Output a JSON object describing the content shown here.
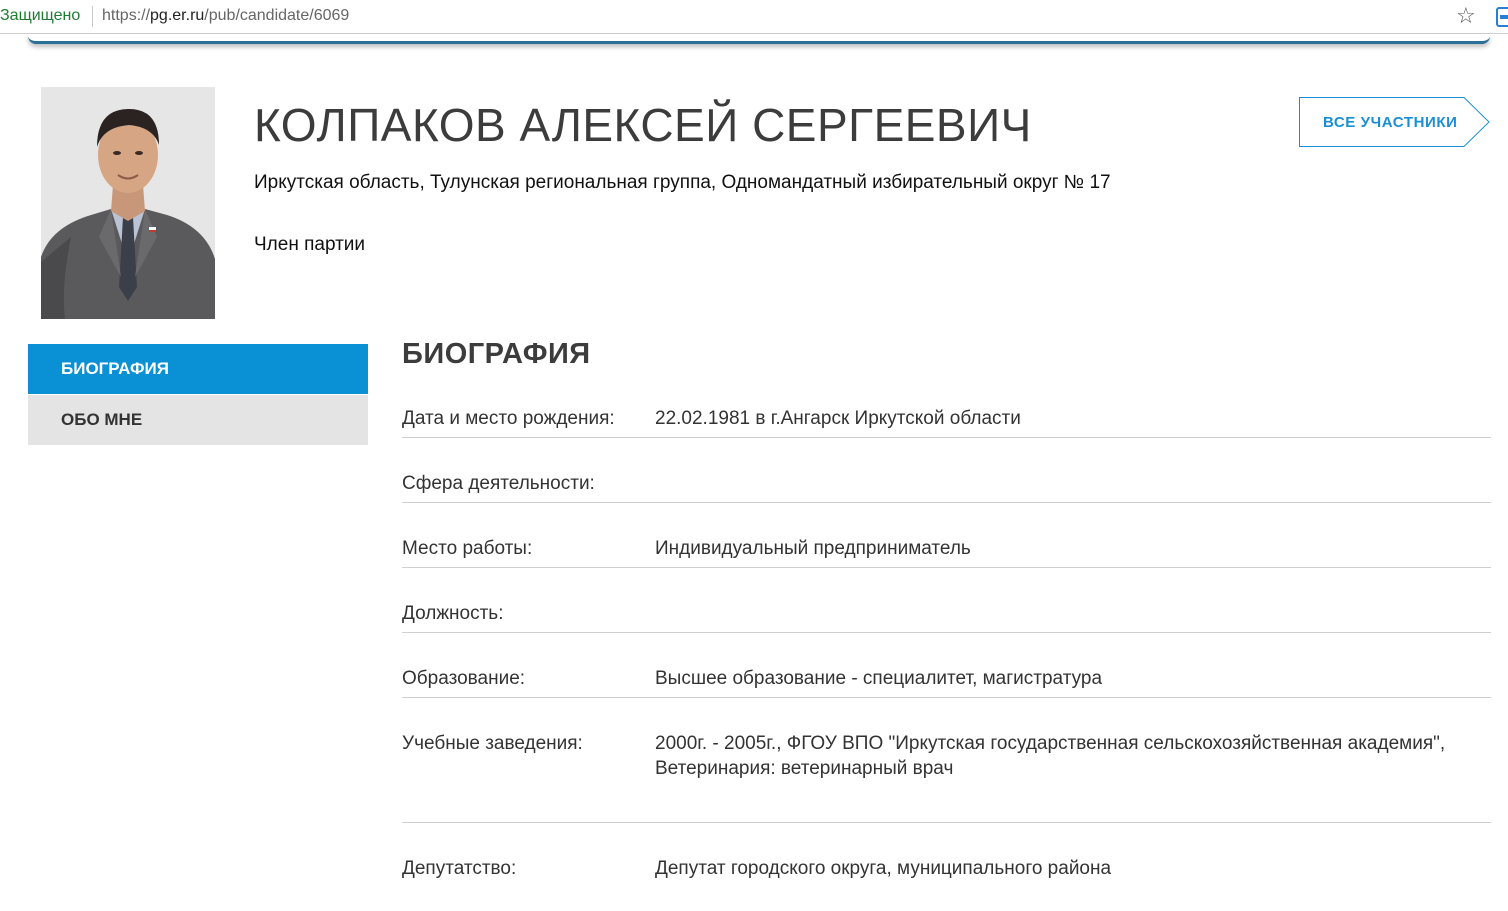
{
  "browser": {
    "secure_label": "Защищено",
    "url_prefix": "https://",
    "url_host": "pg.er.ru",
    "url_path": "/pub/candidate/6069"
  },
  "candidate": {
    "name": "КОЛПАКОВ АЛЕКСЕЙ СЕРГЕЕВИЧ",
    "region": "Иркутская область, Тулунская региональная группа, Одномандатный избирательный округ № 17",
    "status": "Член партии"
  },
  "buttons": {
    "all_participants": "ВСЕ УЧАСТНИКИ"
  },
  "tabs": [
    {
      "label": "БИОГРАФИЯ",
      "active": true
    },
    {
      "label": "ОБО МНЕ",
      "active": false
    }
  ],
  "biography": {
    "title": "БИОГРАФИЯ",
    "rows": [
      {
        "label": "Дата и место рождения:",
        "value": "22.02.1981 в г.Ангарск Иркутской области"
      },
      {
        "label": "Сфера деятельности:",
        "value": ""
      },
      {
        "label": "Место работы:",
        "value": "Индивидуальный предприниматель"
      },
      {
        "label": "Должность:",
        "value": ""
      },
      {
        "label": "Образование:",
        "value": "Высшее образование - специалитет, магистратура"
      },
      {
        "label": "Учебные заведения:",
        "value": "2000г. - 2005г., ФГОУ ВПО \"Иркутская государственная сельскохозяйственная академия\", Ветеринария: ветеринарный врач"
      },
      {
        "label": "Депутатство:",
        "value": "Депутат городского округа, муниципального района"
      }
    ]
  },
  "colors": {
    "accent": "#0a90d5",
    "tab_inactive": "#e4e4e4",
    "heading": "#3c3c3c"
  }
}
